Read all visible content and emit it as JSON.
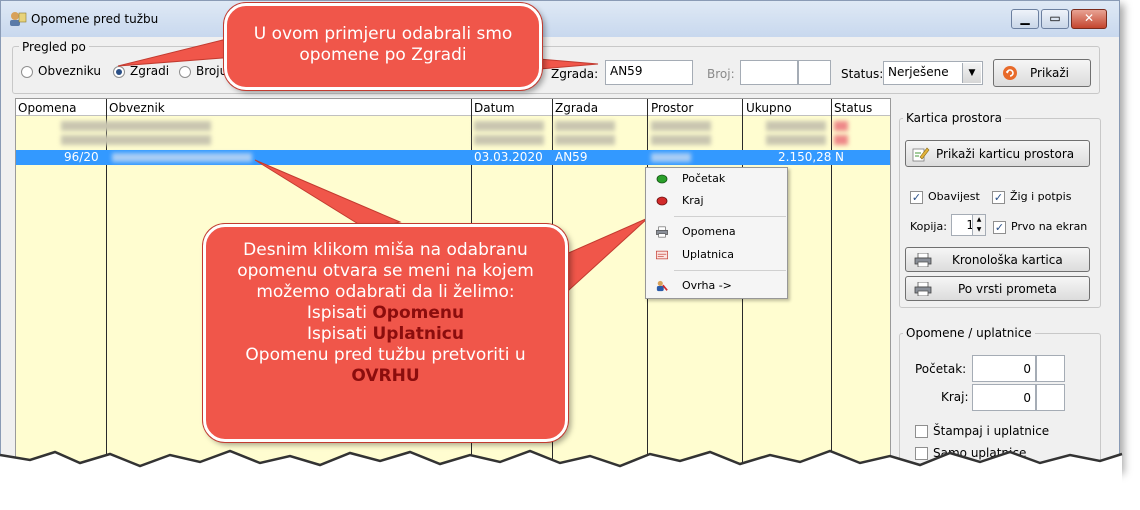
{
  "window": {
    "title": "Opomene pred tužbu",
    "min": "▭",
    "max": "▢",
    "close": "✕"
  },
  "filter": {
    "group_label": "Pregled po",
    "radios": [
      "Obvezniku",
      "Zgradi",
      "Broju"
    ],
    "zgrada_label": "Zgrada:",
    "zgrada_value": "AN59",
    "broj_label": "Broj:",
    "status_label": "Status:",
    "status_value": "Nerješene",
    "prikazi_label": "Prikaži"
  },
  "grid": {
    "columns": [
      "Opomena",
      "Obveznik",
      "Datum",
      "Zgrada",
      "Prostor",
      "Ukupno",
      "Status"
    ],
    "selected_row": {
      "opomena": "96/20",
      "datum": "03.03.2020",
      "zgrada": "AN59",
      "ukupno": "2.150,28",
      "status": "N"
    }
  },
  "context_menu": [
    {
      "label": "Početak",
      "icon": "green-dot-icon"
    },
    {
      "label": "Kraj",
      "icon": "red-dot-icon"
    },
    {
      "label": "Opomena",
      "icon": "printer-icon"
    },
    {
      "label": "Uplatnica",
      "icon": "payment-slip-icon"
    },
    {
      "label": "Ovrha ->",
      "icon": "enforcement-icon"
    }
  ],
  "right_panel": {
    "kartica_group": "Kartica prostora",
    "prikazi_karticu": "Prikaži karticu prostora",
    "obavijest": "Obavijest",
    "zig": "Žig i potpis",
    "kopija_label": "Kopija:",
    "kopija_value": "1",
    "prvo": "Prvo na ekran",
    "kronoloska": "Kronološka kartica",
    "po_vrsti": "Po vrsti prometa",
    "opomene_group": "Opomene / uplatnice",
    "pocetak_label": "Početak:",
    "pocetak_value": "0",
    "kraj_label": "Kraj:",
    "kraj_value": "0",
    "stampaj": "Štampaj i uplatnice",
    "samo": "Samo uplatnice"
  },
  "callouts": {
    "top_line1": "U ovom primjeru odabrali smo",
    "top_line2": "opomene po Zgradi",
    "mid_line1": "Desnim klikom miša na odabranu",
    "mid_line2": "opomenu otvara se meni na kojem",
    "mid_line3": "možemo odabrati da li želimo:",
    "mid_line4a": "Ispisati ",
    "mid_line4b": "Opomenu",
    "mid_line5a": "Ispisati ",
    "mid_line5b": "Uplatnicu",
    "mid_line6": "Opomenu pred tužbu  pretvoriti u",
    "mid_line7": "OVRHU"
  },
  "colors": {
    "accent": "#3399ff",
    "grid_bg": "#fffdd0",
    "callout": "#f0564a",
    "callout_bold": "#8b0d0d"
  }
}
